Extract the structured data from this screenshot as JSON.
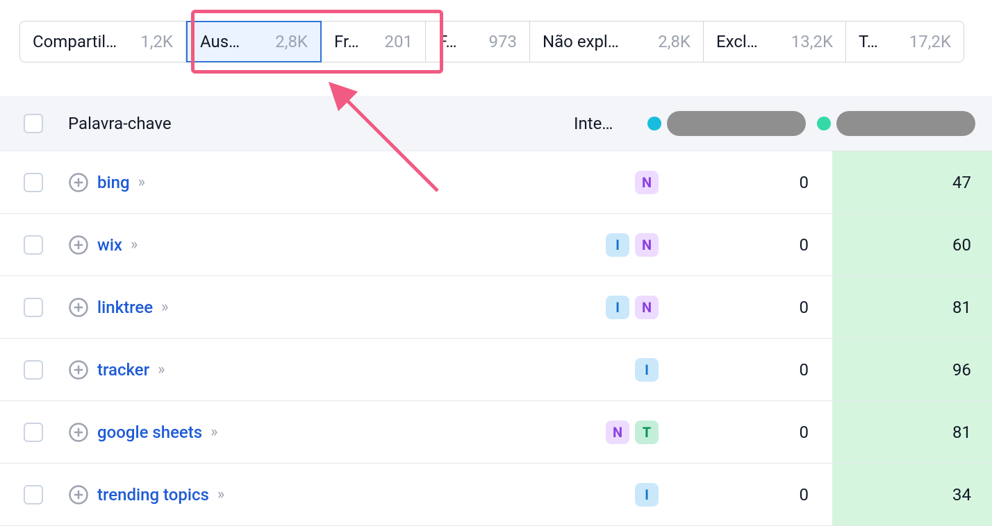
{
  "tabs": [
    {
      "label": "Compartil…",
      "count": "1,2K",
      "active": false
    },
    {
      "label": "Aus…",
      "count": "2,8K",
      "active": true
    },
    {
      "label": "Fr…",
      "count": "201",
      "active": false
    },
    {
      "label": "F…",
      "count": "973",
      "active": false
    },
    {
      "label": "Não expl…",
      "count": "2,8K",
      "active": false
    },
    {
      "label": "Excl…",
      "count": "13,2K",
      "active": false
    },
    {
      "label": "T…",
      "count": "17,2K",
      "active": false
    }
  ],
  "columns": {
    "keyword": "Palavra-chave",
    "intent": "Inte…"
  },
  "colors": {
    "dot_a": "#16bdde",
    "dot_b": "#35d9a8",
    "highlight_col": "#d6f5de",
    "annot": "#f15a82"
  },
  "rows": [
    {
      "keyword": "bing",
      "intents": [
        "N"
      ],
      "col_a": "0",
      "col_b": "47"
    },
    {
      "keyword": "wix",
      "intents": [
        "I",
        "N"
      ],
      "col_a": "0",
      "col_b": "60"
    },
    {
      "keyword": "linktree",
      "intents": [
        "I",
        "N"
      ],
      "col_a": "0",
      "col_b": "81"
    },
    {
      "keyword": "tracker",
      "intents": [
        "I"
      ],
      "col_a": "0",
      "col_b": "96"
    },
    {
      "keyword": "google sheets",
      "intents": [
        "N",
        "T"
      ],
      "col_a": "0",
      "col_b": "81"
    },
    {
      "keyword": "trending topics",
      "intents": [
        "I"
      ],
      "col_a": "0",
      "col_b": "34"
    }
  ]
}
